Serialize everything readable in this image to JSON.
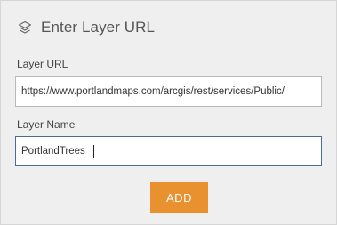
{
  "header": {
    "title": "Enter Layer URL",
    "icon": "layers-icon"
  },
  "layer_url": {
    "label": "Layer URL",
    "value": "https://www.portlandmaps.com/arcgis/rest/services/Public/"
  },
  "layer_name": {
    "label": "Layer Name",
    "value": "PortlandTrees"
  },
  "add_button": {
    "label": "ADD",
    "color": "#e8912e"
  }
}
